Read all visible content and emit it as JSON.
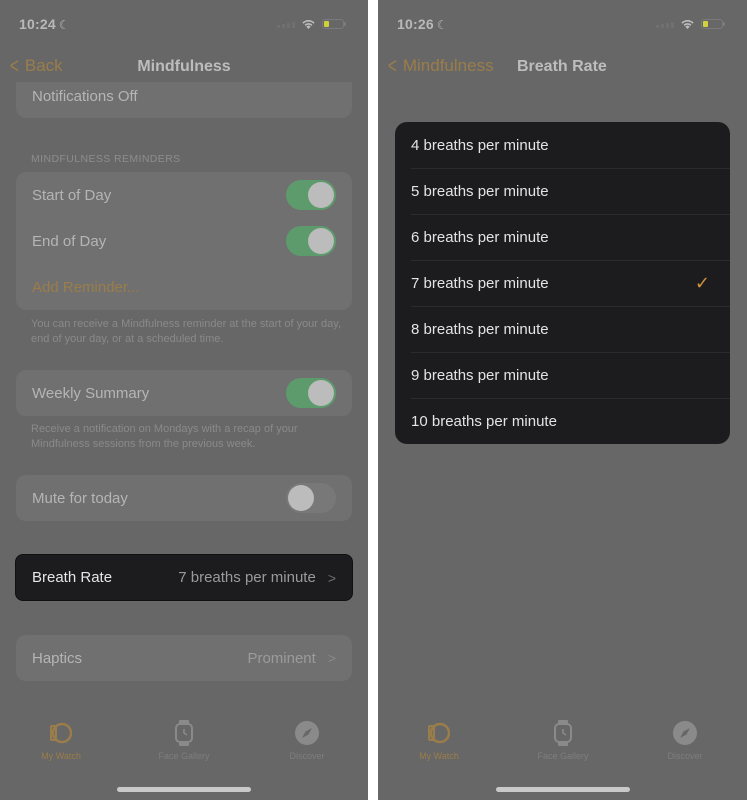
{
  "colors": {
    "accent": "#9a7d4a",
    "toggle_on": "#5e9b6c",
    "check": "#d0913a",
    "dim_background": "#676767",
    "highlight_cell": "#1c1c1e"
  },
  "left_screen": {
    "status_bar": {
      "time": "10:24",
      "focus_icon": "moon-icon"
    },
    "nav": {
      "back_label": "Back",
      "title": "Mindfulness"
    },
    "notifications_row": {
      "label": "Notifications Off"
    },
    "reminders_section": {
      "header": "MINDFULNESS REMINDERS",
      "items": [
        {
          "label": "Start of Day",
          "toggle": true
        },
        {
          "label": "End of Day",
          "toggle": true
        }
      ],
      "add_label": "Add Reminder...",
      "footnote": "You can receive a Mindfulness reminder at the start of your day, end of your day, or at a scheduled time."
    },
    "weekly_summary": {
      "label": "Weekly Summary",
      "toggle": true,
      "footnote": "Receive a notification on Mondays with a recap of your Mindfulness sessions from the previous week."
    },
    "mute": {
      "label": "Mute for today",
      "toggle": false
    },
    "breath_rate": {
      "label": "Breath Rate",
      "value": "7 breaths per minute"
    },
    "haptics": {
      "label": "Haptics",
      "value": "Prominent"
    },
    "tab_bar": [
      {
        "label": "My Watch",
        "icon": "watch-icon",
        "active": true
      },
      {
        "label": "Face Gallery",
        "icon": "face-gallery-icon",
        "active": false
      },
      {
        "label": "Discover",
        "icon": "compass-icon",
        "active": false
      }
    ]
  },
  "right_screen": {
    "status_bar": {
      "time": "10:26",
      "focus_icon": "moon-icon"
    },
    "nav": {
      "back_label": "Mindfulness",
      "title": "Breath Rate"
    },
    "options": [
      {
        "label": "4 breaths per minute",
        "selected": false
      },
      {
        "label": "5 breaths per minute",
        "selected": false
      },
      {
        "label": "6 breaths per minute",
        "selected": false
      },
      {
        "label": "7 breaths per minute",
        "selected": true
      },
      {
        "label": "8 breaths per minute",
        "selected": false
      },
      {
        "label": "9 breaths per minute",
        "selected": false
      },
      {
        "label": "10 breaths per minute",
        "selected": false
      }
    ],
    "check_glyph": "✓",
    "tab_bar": [
      {
        "label": "My Watch",
        "icon": "watch-icon",
        "active": true
      },
      {
        "label": "Face Gallery",
        "icon": "face-gallery-icon",
        "active": false
      },
      {
        "label": "Discover",
        "icon": "compass-icon",
        "active": false
      }
    ]
  }
}
